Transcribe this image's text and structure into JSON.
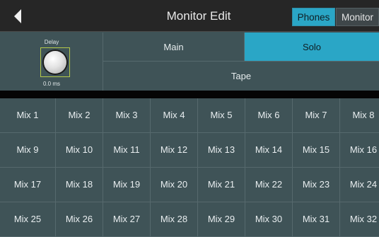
{
  "header": {
    "title": "Monitor Edit",
    "tabs": {
      "phones": "Phones",
      "monitor": "Monitor"
    },
    "back_icon": "back-arrow-icon"
  },
  "delay": {
    "label": "Delay",
    "value": "0.0 ms"
  },
  "buttons": {
    "main": "Main",
    "solo": "Solo",
    "tape": "Tape"
  },
  "mixes": [
    "Mix 1",
    "Mix 2",
    "Mix 3",
    "Mix 4",
    "Mix 5",
    "Mix 6",
    "Mix 7",
    "Mix 8",
    "Mix 9",
    "Mix 10",
    "Mix 11",
    "Mix 12",
    "Mix 13",
    "Mix 14",
    "Mix 15",
    "Mix 16",
    "Mix 17",
    "Mix 18",
    "Mix 19",
    "Mix 20",
    "Mix 21",
    "Mix 22",
    "Mix 23",
    "Mix 24",
    "Mix 25",
    "Mix 26",
    "Mix 27",
    "Mix 28",
    "Mix 29",
    "Mix 30",
    "Mix 31",
    "Mix 32"
  ],
  "colors": {
    "accent": "#2aa6c6",
    "panel": "#3f5357",
    "titlebar": "#262626"
  }
}
